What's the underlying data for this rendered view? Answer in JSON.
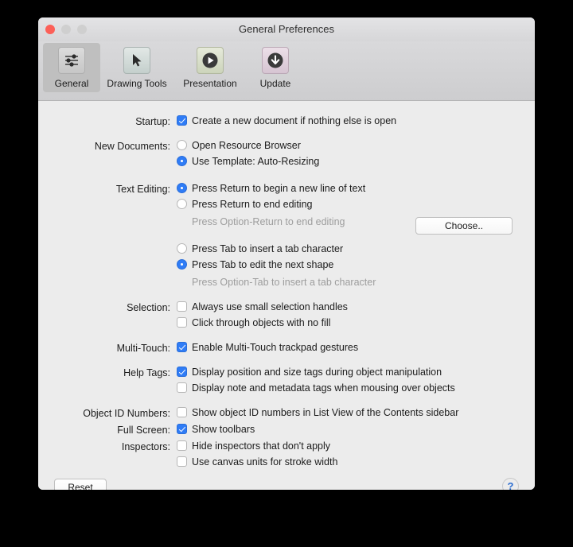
{
  "window": {
    "title": "General Preferences",
    "traffic_lights": [
      "close-button",
      "minimize-button",
      "zoom-button"
    ]
  },
  "toolbar": {
    "items": [
      {
        "label": "General",
        "icon": "sliders-icon",
        "selected": true
      },
      {
        "label": "Drawing Tools",
        "icon": "cursor-arrow-icon",
        "selected": false
      },
      {
        "label": "Presentation",
        "icon": "play-circle-icon",
        "selected": false
      },
      {
        "label": "Update",
        "icon": "download-circle-icon",
        "selected": false
      }
    ]
  },
  "form": {
    "startup": {
      "label": "Startup:",
      "checkbox": {
        "text": "Create a new document if nothing else is open",
        "checked": true
      }
    },
    "new_documents": {
      "label": "New Documents:",
      "options": [
        {
          "text": "Open Resource Browser",
          "selected": false
        },
        {
          "text": "Use Template: Auto-Resizing",
          "selected": true
        }
      ],
      "choose_button": "Choose.."
    },
    "text_editing": {
      "label": "Text Editing:",
      "return_options": [
        {
          "text": "Press Return to begin a new line of text",
          "selected": true
        },
        {
          "text": "Press Return to end editing",
          "selected": false
        }
      ],
      "return_hint": "Press Option-Return to end editing",
      "tab_options": [
        {
          "text": "Press Tab to insert a tab character",
          "selected": false
        },
        {
          "text": "Press Tab to edit the next shape",
          "selected": true
        }
      ],
      "tab_hint": "Press Option-Tab to insert a tab character"
    },
    "selection": {
      "label": "Selection:",
      "checkboxes": [
        {
          "text": "Always use small selection handles",
          "checked": false
        },
        {
          "text": "Click through objects with no fill",
          "checked": false
        }
      ]
    },
    "multi_touch": {
      "label": "Multi-Touch:",
      "checkboxes": [
        {
          "text": "Enable Multi-Touch trackpad gestures",
          "checked": true
        }
      ]
    },
    "help_tags": {
      "label": "Help Tags:",
      "checkboxes": [
        {
          "text": "Display position and size tags during object manipulation",
          "checked": true
        },
        {
          "text": "Display note and metadata tags when mousing over objects",
          "checked": false
        }
      ]
    },
    "object_id_numbers": {
      "label": "Object ID Numbers:",
      "checkboxes": [
        {
          "text": "Show object ID numbers in List View of the Contents sidebar",
          "checked": false
        }
      ]
    },
    "full_screen": {
      "label": "Full Screen:",
      "checkboxes": [
        {
          "text": "Show toolbars",
          "checked": true
        }
      ]
    },
    "inspectors": {
      "label": "Inspectors:",
      "checkboxes": [
        {
          "text": "Hide inspectors that don't apply",
          "checked": false
        },
        {
          "text": "Use canvas units for stroke width",
          "checked": false
        }
      ]
    }
  },
  "bottom_bar": {
    "reset_label": "Reset",
    "help_label": "?"
  },
  "colors": {
    "accent": "#2f7cf6",
    "close_light": "#fc6058",
    "hint_text": "#9d9d9d",
    "help_glyph": "#2f6fd0"
  }
}
